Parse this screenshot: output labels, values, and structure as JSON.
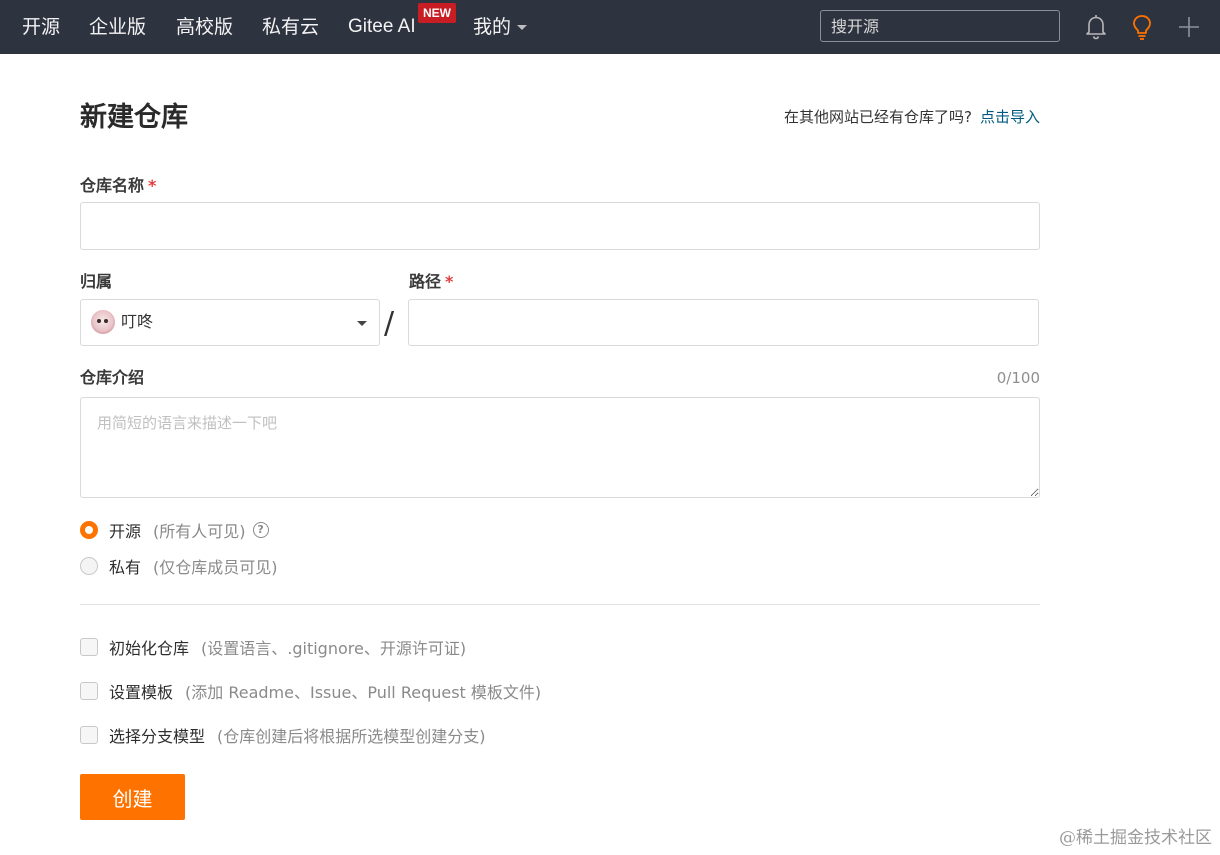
{
  "nav": {
    "items": [
      "开源",
      "企业版",
      "高校版",
      "私有云",
      "Gitee AI"
    ],
    "badge": "NEW",
    "mine": "我的",
    "search_placeholder": "搜开源",
    "icons": [
      "bell-icon",
      "lightbulb-icon",
      "plus-icon"
    ],
    "accent": "#fe7300"
  },
  "page": {
    "title": "新建仓库",
    "import_question": "在其他网站已经有仓库了吗?",
    "import_link": "点击导入"
  },
  "form": {
    "repo_name_label": "仓库名称",
    "required_mark": "*",
    "owner_label": "归属",
    "owner_value": "叮咚",
    "slash": "/",
    "path_label": "路径",
    "desc_label": "仓库介绍",
    "desc_counter": "0/100",
    "desc_placeholder": "用简短的语言来描述一下吧",
    "visibility": [
      {
        "label": "开源",
        "note": "(所有人可见)",
        "selected": true
      },
      {
        "label": "私有",
        "note": "(仅仓库成员可见)",
        "selected": false
      }
    ],
    "help_glyph": "?",
    "options": [
      {
        "label": "初始化仓库",
        "note": "(设置语言、.gitignore、开源许可证)",
        "checked": false
      },
      {
        "label": "设置模板",
        "note": "(添加 Readme、Issue、Pull Request 模板文件)",
        "checked": false
      },
      {
        "label": "选择分支模型",
        "note": "(仓库创建后将根据所选模型创建分支)",
        "checked": false
      }
    ],
    "submit": "创建"
  },
  "watermark": "@稀土掘金技术社区"
}
